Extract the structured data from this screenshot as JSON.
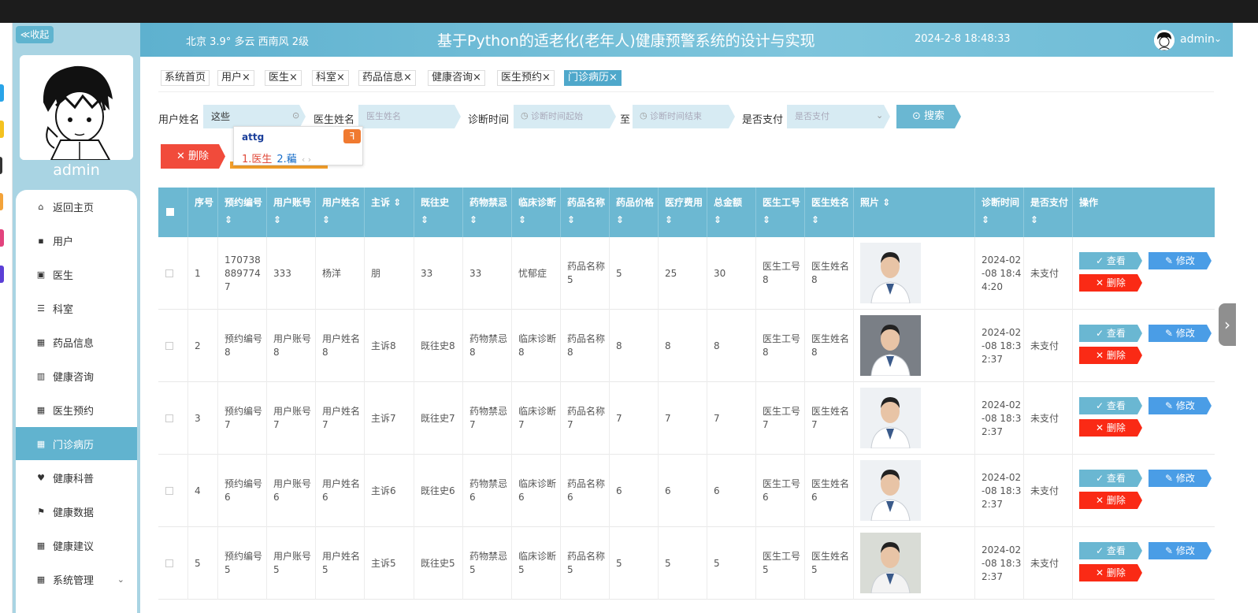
{
  "header": {
    "weather": "北京  3.9°  多云  西南风  2级",
    "title": "基于Python的适老化(老年人)健康预警系统的设计与实现",
    "datetime": "2024-2-8 18:48:33",
    "user": "admin"
  },
  "sidebar": {
    "collapse_label": "≪收起",
    "admin_name": "admin",
    "items": [
      {
        "label": "返回主页",
        "icon": "home-icon"
      },
      {
        "label": "用户",
        "icon": "user-icon"
      },
      {
        "label": "医生",
        "icon": "doctor-icon"
      },
      {
        "label": "科室",
        "icon": "list-icon"
      },
      {
        "label": "药品信息",
        "icon": "grid-icon"
      },
      {
        "label": "健康咨询",
        "icon": "chart-icon"
      },
      {
        "label": "医生预约",
        "icon": "grid-icon"
      },
      {
        "label": "门诊病历",
        "icon": "grid-icon",
        "active": true
      },
      {
        "label": "健康科普",
        "icon": "cup-icon"
      },
      {
        "label": "健康数据",
        "icon": "flag-icon"
      },
      {
        "label": "健康建议",
        "icon": "grid-icon"
      },
      {
        "label": "系统管理",
        "icon": "grid-icon"
      }
    ]
  },
  "tabs": [
    {
      "label": "系统首页"
    },
    {
      "label": "用户×"
    },
    {
      "label": "医生×"
    },
    {
      "label": "科室×"
    },
    {
      "label": "药品信息×"
    },
    {
      "label": "健康咨询×"
    },
    {
      "label": "医生预约×"
    },
    {
      "label": "门诊病历×",
      "active": true
    }
  ],
  "filters": {
    "user_name_label": "用户姓名",
    "user_name_value": "这些",
    "doctor_name_label": "医生姓名",
    "doctor_name_placeholder": "医生姓名",
    "diag_time_label": "诊断时间",
    "diag_start_placeholder": "诊断时间起始",
    "to_label": "至",
    "diag_end_placeholder": "诊断时间结束",
    "paid_label": "是否支付",
    "paid_placeholder": "是否支付",
    "search_label": "搜索"
  },
  "ime": {
    "input": "attg",
    "candidate1": "1.医生",
    "candidate2": "2.藊",
    "nav": "‹ ›"
  },
  "actions": {
    "delete_label": "删除"
  },
  "table": {
    "headers": [
      "序号",
      "预约编号",
      "用户账号",
      "用户姓名",
      "主诉",
      "既往史",
      "药物禁忌",
      "临床诊断",
      "药品名称",
      "药品价格",
      "医疗费用",
      "总金额",
      "医生工号",
      "医生姓名",
      "照片",
      "诊断时间",
      "是否支付",
      "操作"
    ],
    "view_label": "查看",
    "edit_label": "修改",
    "del_label": "删除",
    "rows": [
      {
        "idx": "1",
        "order_no": "1707388897747",
        "account": "333",
        "name": "杨洋",
        "complaint": "朋",
        "history": "33",
        "taboo": "33",
        "diagnosis": "忧郁症",
        "drug": "药品名称5",
        "price": "5",
        "fee": "25",
        "total": "30",
        "doc_no": "医生工号8",
        "doc_name": "医生姓名8",
        "time": "2024-02-08 18:44:20",
        "paid": "未支付"
      },
      {
        "idx": "2",
        "order_no": "预约编号8",
        "account": "用户账号8",
        "name": "用户姓名8",
        "complaint": "主诉8",
        "history": "既往史8",
        "taboo": "药物禁忌8",
        "diagnosis": "临床诊断8",
        "drug": "药品名称8",
        "price": "8",
        "fee": "8",
        "total": "8",
        "doc_no": "医生工号8",
        "doc_name": "医生姓名8",
        "time": "2024-02-08 18:32:37",
        "paid": "未支付"
      },
      {
        "idx": "3",
        "order_no": "预约编号7",
        "account": "用户账号7",
        "name": "用户姓名7",
        "complaint": "主诉7",
        "history": "既往史7",
        "taboo": "药物禁忌7",
        "diagnosis": "临床诊断7",
        "drug": "药品名称7",
        "price": "7",
        "fee": "7",
        "total": "7",
        "doc_no": "医生工号7",
        "doc_name": "医生姓名7",
        "time": "2024-02-08 18:32:37",
        "paid": "未支付"
      },
      {
        "idx": "4",
        "order_no": "预约编号6",
        "account": "用户账号6",
        "name": "用户姓名6",
        "complaint": "主诉6",
        "history": "既往史6",
        "taboo": "药物禁忌6",
        "diagnosis": "临床诊断6",
        "drug": "药品名称6",
        "price": "6",
        "fee": "6",
        "total": "6",
        "doc_no": "医生工号6",
        "doc_name": "医生姓名6",
        "time": "2024-02-08 18:32:37",
        "paid": "未支付"
      },
      {
        "idx": "5",
        "order_no": "预约编号5",
        "account": "用户账号5",
        "name": "用户姓名5",
        "complaint": "主诉5",
        "history": "既往史5",
        "taboo": "药物禁忌5",
        "diagnosis": "临床诊断5",
        "drug": "药品名称5",
        "price": "5",
        "fee": "5",
        "total": "5",
        "doc_no": "医生工号5",
        "doc_name": "医生姓名5",
        "time": "2024-02-08 18:32:37",
        "paid": "未支付"
      }
    ]
  },
  "colors": {
    "primary": "#61b3cf",
    "sidebar": "#a9d4e3",
    "danger": "#fa2a15",
    "edit": "#4a9de6"
  }
}
